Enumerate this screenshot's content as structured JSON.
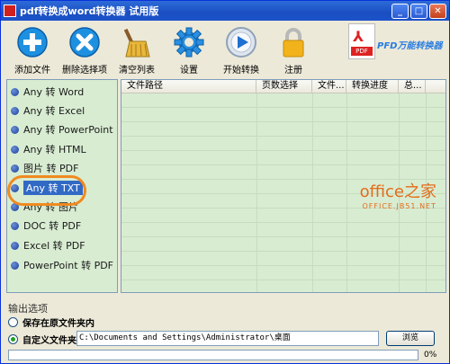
{
  "window": {
    "title": "pdf转换成word转换器 试用版"
  },
  "toolbar": {
    "items": [
      {
        "label": "添加文件",
        "icon": "add-icon"
      },
      {
        "label": "删除选择项",
        "icon": "delete-icon"
      },
      {
        "label": "清空列表",
        "icon": "broom-icon"
      },
      {
        "label": "设置",
        "icon": "gear-icon"
      },
      {
        "label": "开始转换",
        "icon": "play-icon"
      },
      {
        "label": "注册",
        "icon": "lock-icon"
      }
    ],
    "brand": {
      "name": "PFD万能转换器",
      "badge": "PDF"
    }
  },
  "conversions": {
    "items": [
      {
        "label": "Any 转 Word"
      },
      {
        "label": "Any 转 Excel"
      },
      {
        "label": "Any 转 PowerPoint"
      },
      {
        "label": "Any 转 HTML"
      },
      {
        "label": "图片 转 PDF"
      },
      {
        "label": "Any 转 TXT",
        "selected": true
      },
      {
        "label": "Any 转 图片"
      },
      {
        "label": "DOC 转 PDF"
      },
      {
        "label": "Excel 转 PDF"
      },
      {
        "label": "PowerPoint 转 PDF"
      }
    ]
  },
  "filelist": {
    "columns": [
      "文件路径",
      "页数选择",
      "文件...",
      "转换进度",
      "总..."
    ]
  },
  "watermark": {
    "main": "office之家",
    "sub": "OFFICE.JB51.NET"
  },
  "output": {
    "section_title": "输出选项",
    "option_original": "保存在原文件夹内",
    "option_custom": "自定义文件夹",
    "selected": "custom",
    "path": "C:\\Documents and Settings\\Administrator\\桌面",
    "browse_label": "浏览"
  },
  "progress": {
    "value": 0,
    "label": "0%"
  }
}
